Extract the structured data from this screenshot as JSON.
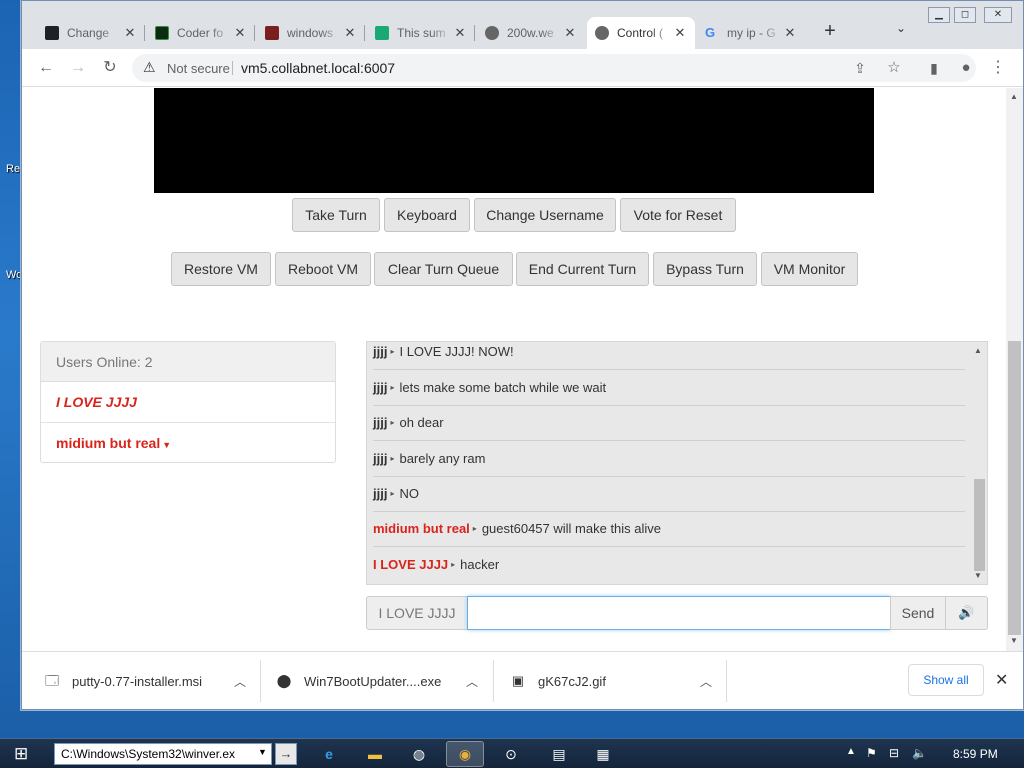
{
  "desktop": {
    "labels": [
      "Re",
      "Wo"
    ]
  },
  "tabs": [
    {
      "title": "Change",
      "active": false
    },
    {
      "title": "Coder fo",
      "active": false
    },
    {
      "title": "windows",
      "active": false
    },
    {
      "title": "This sum",
      "active": false
    },
    {
      "title": "200w.we",
      "active": false
    },
    {
      "title": "Control (",
      "active": true
    },
    {
      "title": "my ip - G",
      "active": false
    }
  ],
  "toolbar": {
    "security": "Not secure",
    "url": "vm5.collabnet.local:6007"
  },
  "buttons_row1": [
    "Take Turn",
    "Keyboard",
    "Change Username",
    "Vote for Reset"
  ],
  "buttons_row2": [
    "Restore VM",
    "Reboot VM",
    "Clear Turn Queue",
    "End Current Turn",
    "Bypass Turn",
    "VM Monitor"
  ],
  "users": {
    "header": "Users Online: 2",
    "list": [
      "I LOVE JJJJ",
      "midium but real"
    ]
  },
  "chat": [
    {
      "name": "jjjj",
      "text": "I LOVE JJJJ! NOW!",
      "red": false
    },
    {
      "name": "jjjj",
      "text": "lets make some batch while we wait",
      "red": false
    },
    {
      "name": "jjjj",
      "text": "oh dear",
      "red": false
    },
    {
      "name": "jjjj",
      "text": "barely any ram",
      "red": false
    },
    {
      "name": "jjjj",
      "text": "NO",
      "red": false
    },
    {
      "name": "midium but real",
      "text": "guest60457 will make this alive",
      "red": true
    },
    {
      "name": "I LOVE JJJJ",
      "text": "hacker",
      "red": true
    }
  ],
  "input": {
    "username": "I LOVE JJJJ",
    "value": "",
    "send": "Send"
  },
  "downloads": {
    "items": [
      "putty-0.77-installer.msi",
      "Win7BootUpdater....exe",
      "gK67cJ2.gif"
    ],
    "show_all": "Show all"
  },
  "taskbar": {
    "run_text": "C:\\Windows\\System32\\winver.ex",
    "time": "8:59 PM"
  }
}
